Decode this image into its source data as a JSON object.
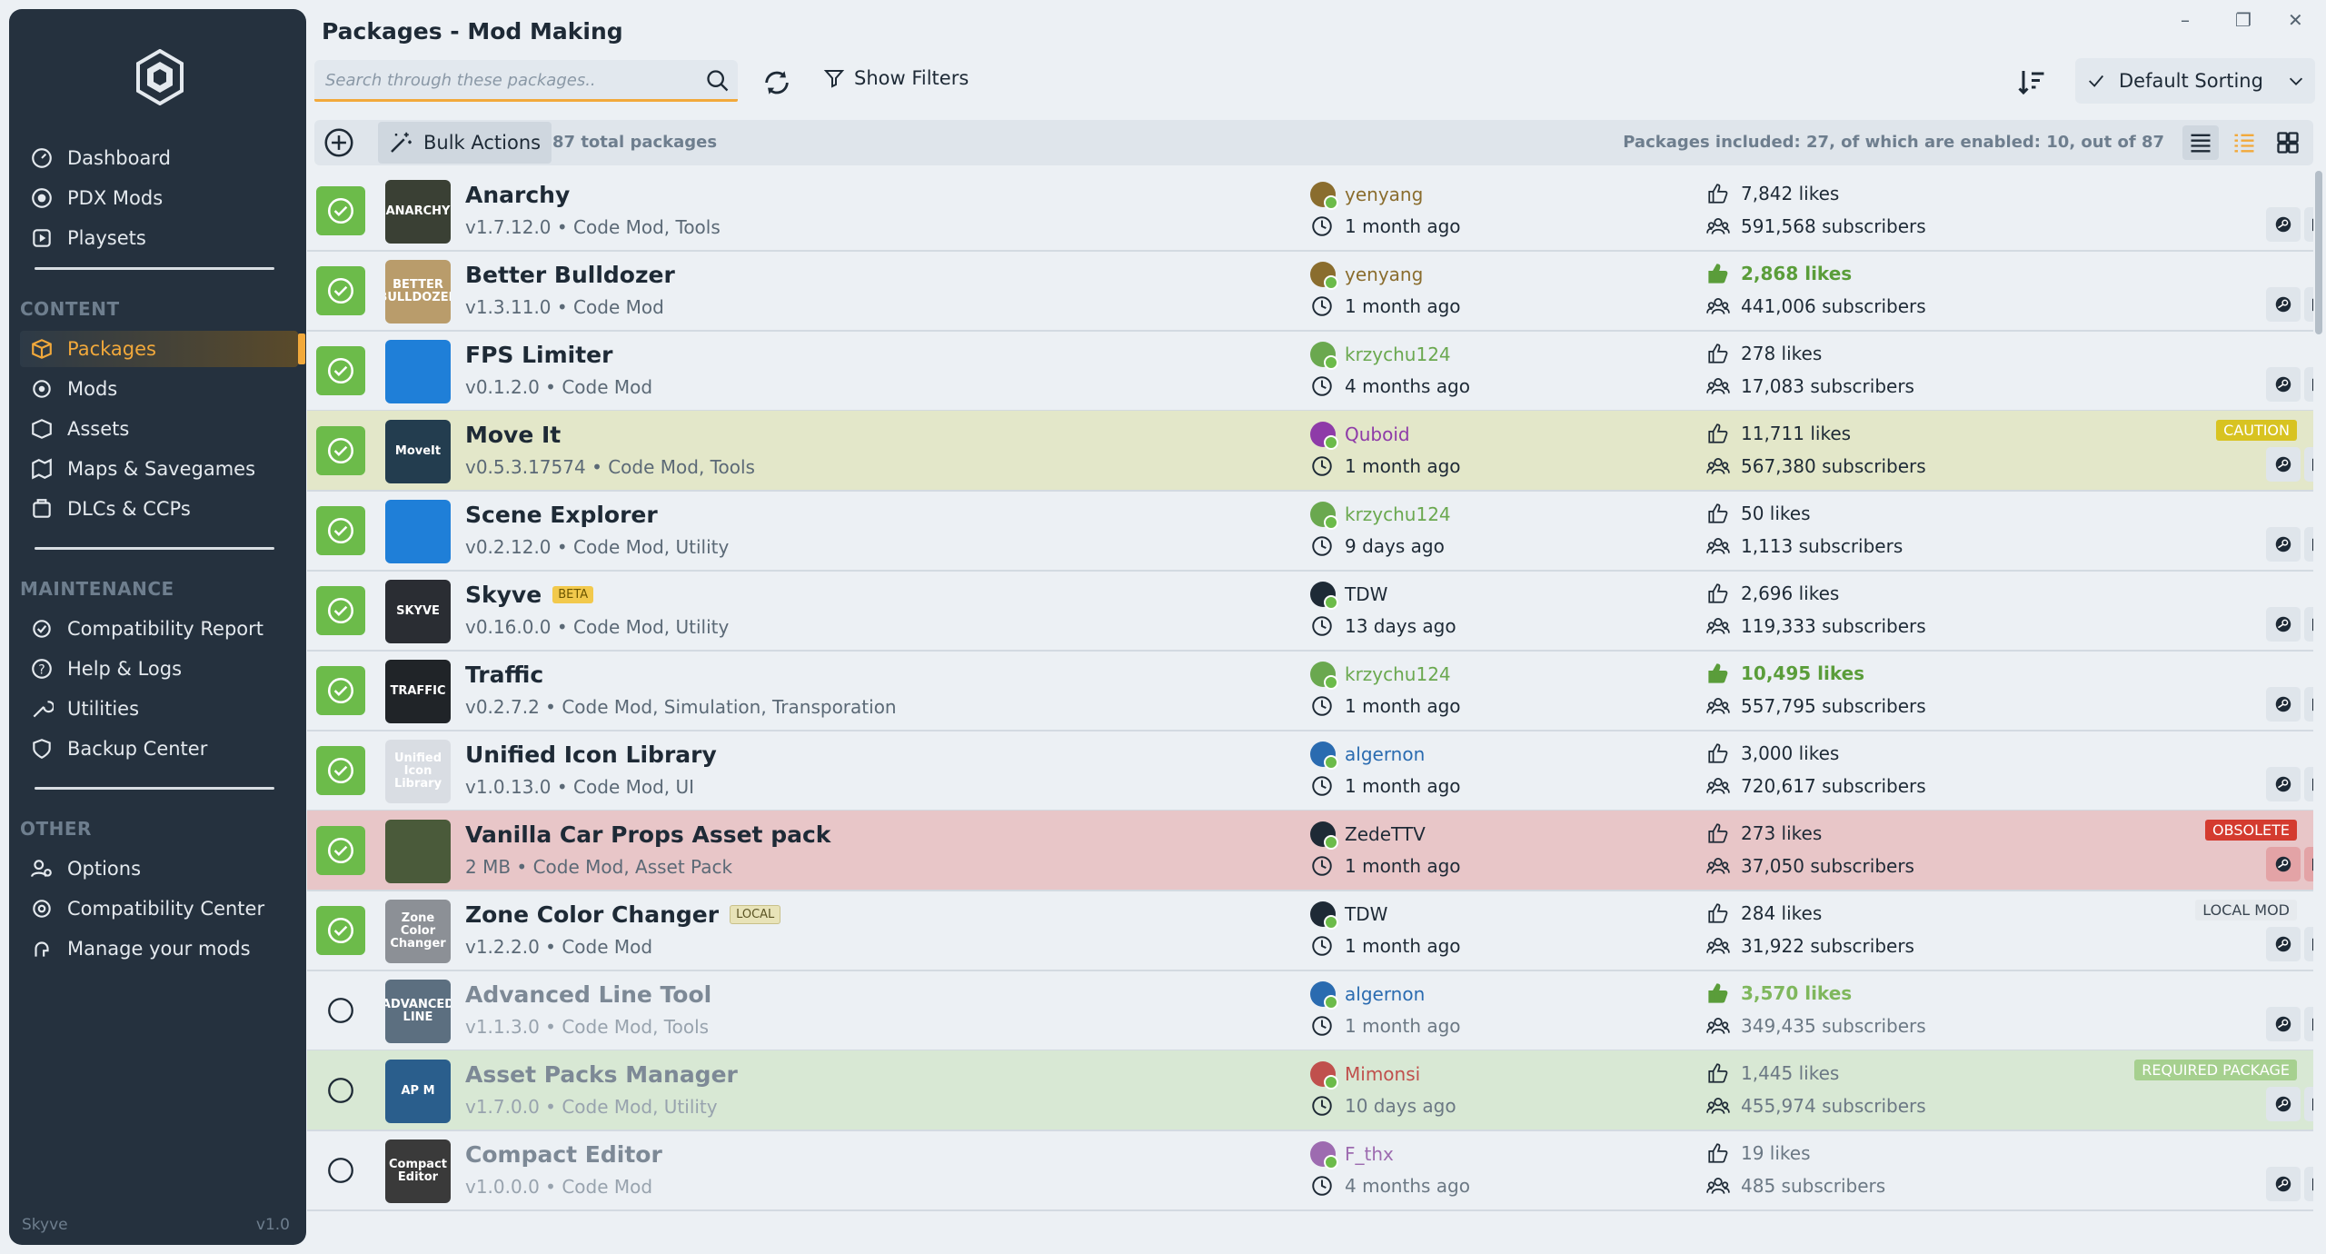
{
  "app": {
    "title": "Packages - Mod Making"
  },
  "window": {
    "minimize": "–",
    "restore": "❐",
    "close": "✕"
  },
  "sidebar": {
    "main": [
      {
        "label": "Dashboard",
        "icon": "dashboard-icon"
      },
      {
        "label": "PDX Mods",
        "icon": "pdx-icon"
      },
      {
        "label": "Playsets",
        "icon": "playsets-icon"
      }
    ],
    "content_title": "CONTENT",
    "content": [
      {
        "label": "Packages",
        "icon": "packages-icon",
        "active": true
      },
      {
        "label": "Mods",
        "icon": "mods-icon"
      },
      {
        "label": "Assets",
        "icon": "assets-icon"
      },
      {
        "label": "Maps & Savegames",
        "icon": "maps-icon"
      },
      {
        "label": "DLCs & CCPs",
        "icon": "dlc-icon"
      }
    ],
    "maintenance_title": "MAINTENANCE",
    "maintenance": [
      {
        "label": "Compatibility Report",
        "icon": "compat-report-icon"
      },
      {
        "label": "Help & Logs",
        "icon": "help-icon"
      },
      {
        "label": "Utilities",
        "icon": "utilities-icon"
      },
      {
        "label": "Backup Center",
        "icon": "backup-icon"
      }
    ],
    "other_title": "OTHER",
    "other": [
      {
        "label": "Options",
        "icon": "options-icon"
      },
      {
        "label": "Compatibility Center",
        "icon": "compat-center-icon"
      },
      {
        "label": "Manage your mods",
        "icon": "manage-icon"
      }
    ],
    "footer_name": "Skyve",
    "footer_version": "v1.0"
  },
  "search": {
    "placeholder": "Search through these packages.."
  },
  "filters": {
    "label": "Show Filters"
  },
  "sorting": {
    "label": "Default Sorting"
  },
  "toolbar": {
    "bulk_label": "Bulk Actions",
    "total": "87 total packages",
    "included": "Packages included: 27, of which are enabled: 10, out of 87"
  },
  "colors": {
    "accent": "#f2a93b",
    "enabled": "#6cbb4a",
    "sidebar": "#25313e"
  },
  "packages": [
    {
      "name": "Anarchy",
      "meta": "v1.7.12.0 • Code Mod, Tools",
      "author": "yenyang",
      "author_color": "#8a6d2e",
      "updated": "1 month ago",
      "likes": "7,842 likes",
      "subs": "591,568 subscribers",
      "enabled": true,
      "thumb": "ANARCHY",
      "thumb_bg": "#3a4034"
    },
    {
      "name": "Better Bulldozer",
      "meta": "v1.3.11.0 • Code Mod",
      "author": "yenyang",
      "author_color": "#8a6d2e",
      "updated": "1 month ago",
      "likes": "2,868 likes",
      "hot": true,
      "subs": "441,006 subscribers",
      "enabled": true,
      "thumb": "BETTER BULLDOZER",
      "thumb_bg": "#b99c6b"
    },
    {
      "name": "FPS Limiter",
      "meta": "v0.1.2.0 • Code Mod",
      "author": "krzychu124",
      "author_color": "#6aa84f",
      "updated": "4 months ago",
      "likes": "278 likes",
      "subs": "17,083 subscribers",
      "enabled": true,
      "thumb": "",
      "thumb_bg": "#1f7fd8"
    },
    {
      "name": "Move It",
      "meta": "v0.5.3.17574 • Code Mod, Tools",
      "author": "Quboid",
      "author_color": "#8e3ba8",
      "updated": "1 month ago",
      "likes": "11,711 likes",
      "subs": "567,380 subscribers",
      "enabled": true,
      "thumb": "MoveIt",
      "thumb_bg": "#233d4f",
      "badge": "CAUTION",
      "badge_type": "caution"
    },
    {
      "name": "Scene Explorer",
      "meta": "v0.2.12.0 • Code Mod, Utility",
      "author": "krzychu124",
      "author_color": "#6aa84f",
      "updated": "9 days ago",
      "likes": "50 likes",
      "subs": "1,113 subscribers",
      "enabled": true,
      "thumb": "",
      "thumb_bg": "#1f7fd8"
    },
    {
      "name": "Skyve",
      "tag": "BETA",
      "meta": "v0.16.0.0 • Code Mod, Utility",
      "author": "TDW",
      "author_color": "#1e2a36",
      "updated": "13 days ago",
      "likes": "2,696 likes",
      "subs": "119,333 subscribers",
      "enabled": true,
      "thumb": "SKYVE",
      "thumb_bg": "#2a2d33"
    },
    {
      "name": "Traffic",
      "meta": "v0.2.7.2 • Code Mod, Simulation, Transporation",
      "author": "krzychu124",
      "author_color": "#6aa84f",
      "updated": "1 month ago",
      "likes": "10,495 likes",
      "hot": true,
      "subs": "557,795 subscribers",
      "enabled": true,
      "thumb": "TRAFFIC",
      "thumb_bg": "#202428"
    },
    {
      "name": "Unified Icon Library",
      "meta": "v1.0.13.0 • Code Mod, UI",
      "author": "algernon",
      "author_color": "#2a6bb0",
      "updated": "1 month ago",
      "likes": "3,000 likes",
      "subs": "720,617 subscribers",
      "enabled": true,
      "thumb": "Unified Icon Library",
      "thumb_bg": "#d9dde3"
    },
    {
      "name": "Vanilla Car Props Asset pack",
      "meta": "2 MB • Code Mod, Asset Pack",
      "author": "ZedeTTV",
      "author_color": "#1e2a36",
      "updated": "1 month ago",
      "likes": "273 likes",
      "subs": "37,050 subscribers",
      "enabled": true,
      "thumb": "",
      "thumb_bg": "#4a5a3a",
      "badge": "OBSOLETE",
      "badge_type": "obsolete"
    },
    {
      "name": "Zone Color Changer",
      "tag": "LOCAL",
      "meta": "v1.2.2.0 • Code Mod",
      "author": "TDW",
      "author_color": "#1e2a36",
      "updated": "1 month ago",
      "likes": "284 likes",
      "subs": "31,922 subscribers",
      "enabled": true,
      "thumb": "Zone Color Changer",
      "thumb_bg": "#8c9096",
      "badge": "LOCAL MOD",
      "badge_type": "localmod"
    },
    {
      "name": "Advanced Line Tool",
      "meta": "v1.1.3.0 • Code Mod, Tools",
      "author": "algernon",
      "author_color": "#2a6bb0",
      "updated": "1 month ago",
      "likes": "3,570 likes",
      "hot": true,
      "subs": "349,435 subscribers",
      "enabled": false,
      "thumb": "ADVANCED LINE",
      "thumb_bg": "#5c6f80"
    },
    {
      "name": "Asset Packs Manager",
      "meta": "v1.7.0.0 • Code Mod, Utility",
      "author": "Mimonsi",
      "author_color": "#c0504d",
      "updated": "10 days ago",
      "likes": "1,445 likes",
      "subs": "455,974 subscribers",
      "enabled": false,
      "thumb": "AP M",
      "thumb_bg": "#2a5e8c",
      "badge": "REQUIRED PACKAGE",
      "badge_type": "required"
    },
    {
      "name": "Compact Editor",
      "meta": "v1.0.0.0 • Code Mod",
      "author": "F_thx",
      "author_color": "#9d6bb0",
      "updated": "4 months ago",
      "likes": "19 likes",
      "subs": "485 subscribers",
      "enabled": false,
      "thumb": "Compact Editor",
      "thumb_bg": "#3a3a3a"
    }
  ]
}
